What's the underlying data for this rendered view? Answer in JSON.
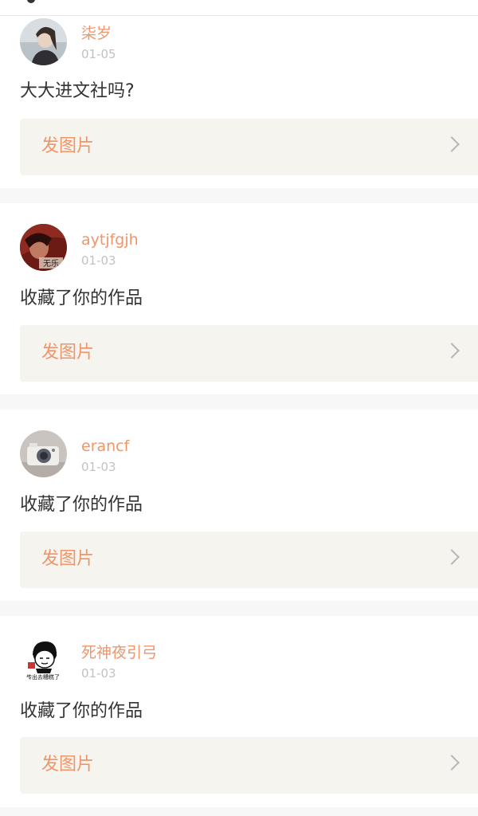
{
  "action_label": "发图片",
  "items": [
    {
      "username": "柒岁",
      "date": "01-05",
      "message": "大大进文社吗?",
      "avatar_icon": "girl-portrait-avatar"
    },
    {
      "username": "aytjfgjh",
      "date": "01-03",
      "message": "收藏了你的作品",
      "avatar_icon": "dark-red-portrait-avatar",
      "avatar_text": "无乐"
    },
    {
      "username": "erancf",
      "date": "01-03",
      "message": "收藏了你的作品",
      "avatar_icon": "camera-avatar"
    },
    {
      "username": "死神夜引弓",
      "date": "01-03",
      "message": "收藏了你的作品",
      "avatar_icon": "meme-cartoon-avatar",
      "avatar_text": "传出去糟糕了"
    }
  ]
}
